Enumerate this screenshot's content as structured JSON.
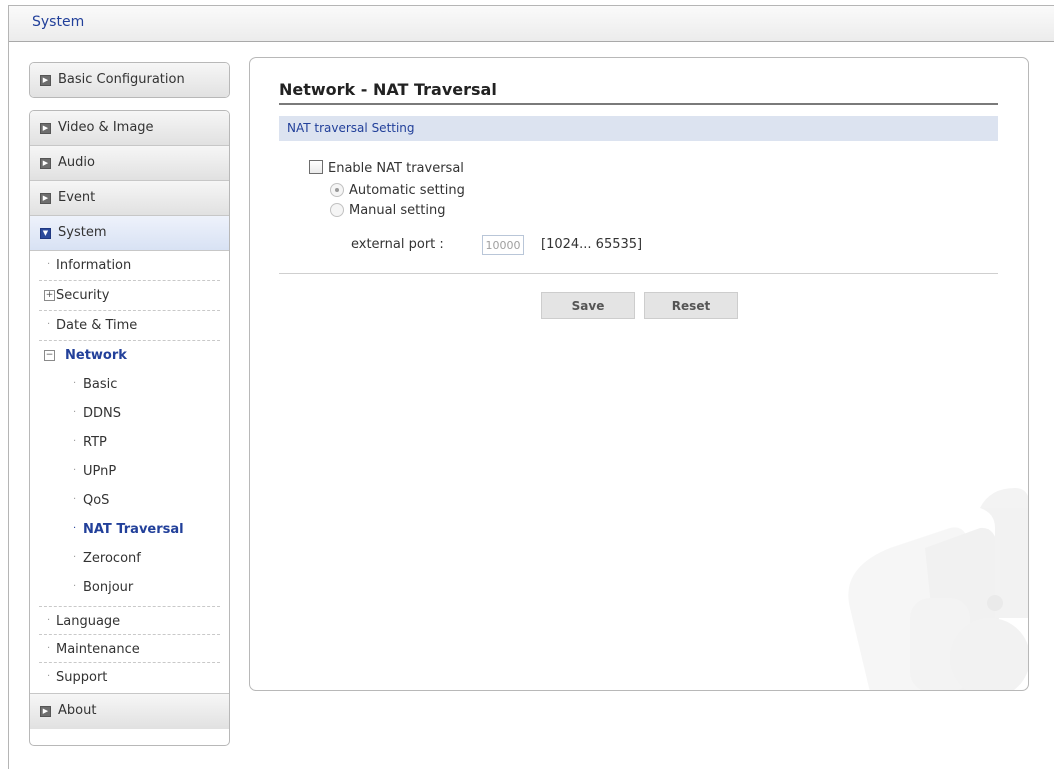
{
  "header": {
    "title": "System"
  },
  "sidebar": {
    "basic_configuration": "Basic Configuration",
    "video_image": "Video & Image",
    "audio": "Audio",
    "event": "Event",
    "system": "System",
    "system_items": {
      "information": "Information",
      "security": "Security",
      "date_time": "Date & Time",
      "network": "Network",
      "network_items": [
        "Basic",
        "DDNS",
        "RTP",
        "UPnP",
        "QoS",
        "NAT Traversal",
        "Zeroconf",
        "Bonjour"
      ],
      "language": "Language",
      "maintenance": "Maintenance",
      "support": "Support"
    },
    "about": "About"
  },
  "main": {
    "page_title": "Network - NAT Traversal",
    "section_title": "NAT traversal Setting",
    "enable_label": "Enable NAT traversal",
    "enable_checked": false,
    "automatic_label": "Automatic setting",
    "manual_label": "Manual setting",
    "selected_mode": "Automatic setting",
    "external_port_label": "external port :",
    "external_port_value": "10000",
    "external_port_range": "[1024... 65535]",
    "save_label": "Save",
    "reset_label": "Reset"
  },
  "colors": {
    "accent": "#22409a",
    "section_bar": "#dce3f0"
  }
}
